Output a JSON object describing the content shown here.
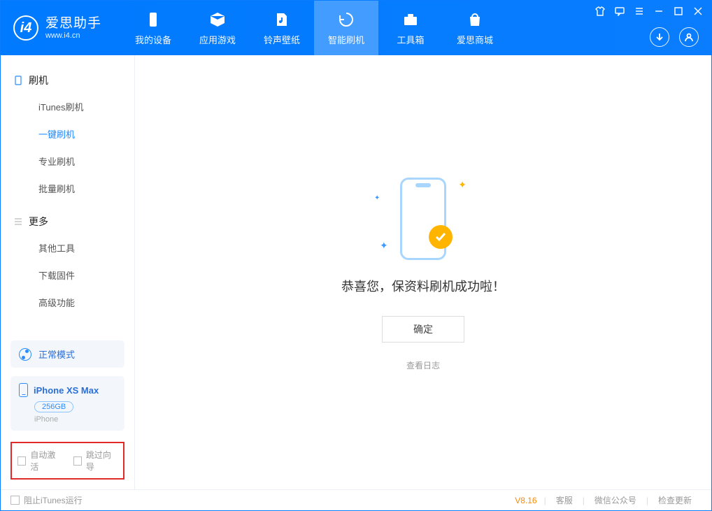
{
  "app": {
    "name": "爱思助手",
    "url": "www.i4.cn"
  },
  "tabs": [
    {
      "label": "我的设备"
    },
    {
      "label": "应用游戏"
    },
    {
      "label": "铃声壁纸"
    },
    {
      "label": "智能刷机"
    },
    {
      "label": "工具箱"
    },
    {
      "label": "爱思商城"
    }
  ],
  "sidebar": {
    "group1_title": "刷机",
    "items1": [
      {
        "label": "iTunes刷机"
      },
      {
        "label": "一键刷机"
      },
      {
        "label": "专业刷机"
      },
      {
        "label": "批量刷机"
      }
    ],
    "group2_title": "更多",
    "items2": [
      {
        "label": "其他工具"
      },
      {
        "label": "下载固件"
      },
      {
        "label": "高级功能"
      }
    ]
  },
  "mode": {
    "label": "正常模式"
  },
  "device": {
    "name": "iPhone XS Max",
    "capacity": "256GB",
    "type": "iPhone"
  },
  "options": {
    "auto_activate": "自动激活",
    "skip_guide": "跳过向导"
  },
  "result": {
    "message": "恭喜您，保资料刷机成功啦！",
    "ok": "确定",
    "view_log": "查看日志"
  },
  "footer": {
    "block_itunes": "阻止iTunes运行",
    "version": "V8.16",
    "support": "客服",
    "wechat": "微信公众号",
    "check_update": "检查更新"
  }
}
